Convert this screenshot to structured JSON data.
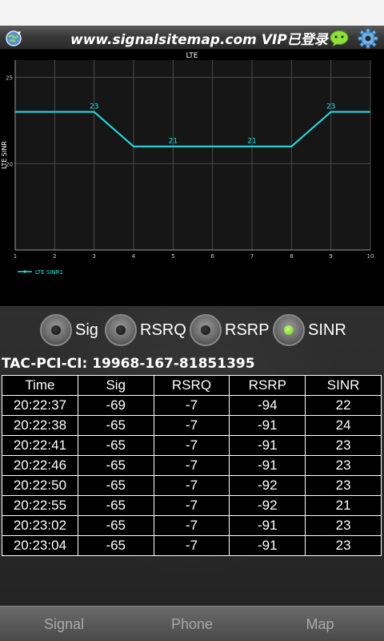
{
  "app": {
    "title": "www.signalsitemap.com VIP已登录"
  },
  "icons": {
    "globe": "globe-icon",
    "chat": "chat-icon",
    "settings": "gear-icon"
  },
  "chart_data": {
    "type": "line",
    "title": "LTE",
    "ylabel": "LTE SINR",
    "xlabel": "",
    "x": [
      1,
      2,
      3,
      4,
      5,
      6,
      7,
      8,
      9,
      10
    ],
    "xticks": [
      "1",
      "2",
      "3",
      "4",
      "5",
      "6",
      "7",
      "8",
      "9",
      "10"
    ],
    "yticks": [
      "20",
      "25"
    ],
    "ylim": [
      15,
      26
    ],
    "series": [
      {
        "name": "LTE SINR1",
        "values": [
          23,
          23,
          23,
          21,
          21,
          21,
          21,
          21,
          23,
          23
        ],
        "color": "#22e3ea",
        "data_labels": [
          {
            "x": 3,
            "label": "23"
          },
          {
            "x": 5,
            "label": "21"
          },
          {
            "x": 7,
            "label": "21"
          },
          {
            "x": 9,
            "label": "23"
          }
        ]
      }
    ],
    "grid": true,
    "legend_position": "bottom-left"
  },
  "radios": [
    {
      "label": "Sig",
      "selected": false
    },
    {
      "label": "RSRQ",
      "selected": false
    },
    {
      "label": "RSRP",
      "selected": false
    },
    {
      "label": "SINR",
      "selected": true
    }
  ],
  "tac_line": "TAC-PCI-CI: 19968-167-81851395",
  "table": {
    "headers": [
      "Time",
      "Sig",
      "RSRQ",
      "RSRP",
      "SINR"
    ],
    "rows": [
      [
        "20:22:37",
        "-69",
        "-7",
        "-94",
        "22"
      ],
      [
        "20:22:38",
        "-65",
        "-7",
        "-91",
        "24"
      ],
      [
        "20:22:41",
        "-65",
        "-7",
        "-91",
        "23"
      ],
      [
        "20:22:46",
        "-65",
        "-7",
        "-91",
        "23"
      ],
      [
        "20:22:50",
        "-65",
        "-7",
        "-92",
        "23"
      ],
      [
        "20:22:55",
        "-65",
        "-7",
        "-92",
        "21"
      ],
      [
        "20:23:02",
        "-65",
        "-7",
        "-91",
        "23"
      ],
      [
        "20:23:04",
        "-65",
        "-7",
        "-91",
        "23"
      ]
    ]
  },
  "tabs": [
    {
      "label": "Signal"
    },
    {
      "label": "Phone"
    },
    {
      "label": "Map"
    }
  ]
}
